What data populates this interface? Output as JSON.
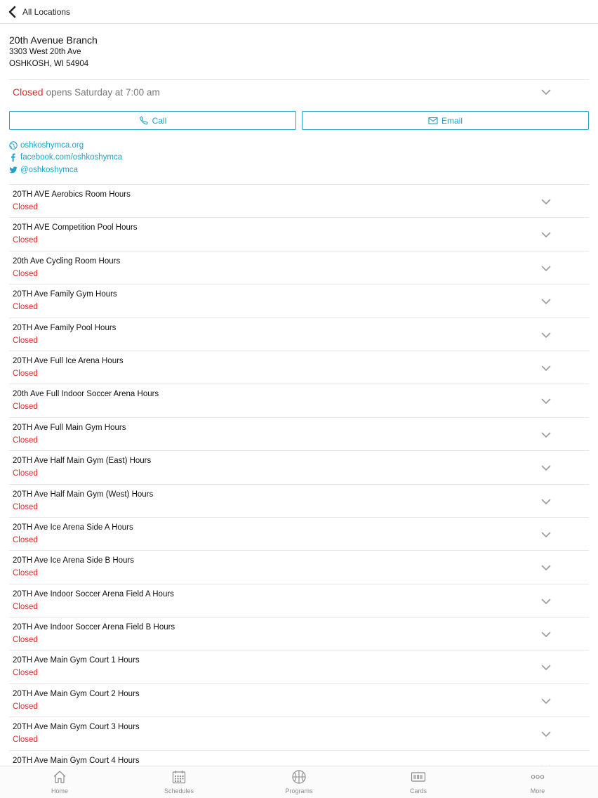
{
  "header": {
    "back_label": "All Locations"
  },
  "location": {
    "name": "20th Avenue Branch",
    "address_line1": "3303 West 20th Ave",
    "address_line2": "OSHKOSH, WI 54904"
  },
  "status": {
    "state": "Closed",
    "detail": "opens Saturday at 7:00 am"
  },
  "actions": {
    "call_label": "Call",
    "email_label": "Email"
  },
  "links": {
    "website": "oshkoshymca.org",
    "facebook": "facebook.com/oshkoshymca",
    "twitter": "@oshkoshymca"
  },
  "facilities": [
    {
      "title": "20TH AVE Aerobics Room Hours",
      "status": "Closed"
    },
    {
      "title": "20TH AVE Competition Pool Hours",
      "status": "Closed"
    },
    {
      "title": "20th Ave Cycling Room Hours",
      "status": "Closed"
    },
    {
      "title": "20TH Ave Family Gym Hours",
      "status": "Closed"
    },
    {
      "title": "20TH Ave Family Pool Hours",
      "status": "Closed"
    },
    {
      "title": "20TH Ave Full Ice Arena Hours",
      "status": "Closed"
    },
    {
      "title": "20th Ave Full Indoor Soccer Arena Hours",
      "status": "Closed"
    },
    {
      "title": "20TH Ave Full Main Gym Hours",
      "status": "Closed"
    },
    {
      "title": "20TH Ave Half Main Gym (East) Hours",
      "status": "Closed"
    },
    {
      "title": "20TH Ave Half Main Gym (West) Hours",
      "status": "Closed"
    },
    {
      "title": "20TH Ave Ice Arena Side A Hours",
      "status": "Closed"
    },
    {
      "title": "20TH Ave Ice Arena Side B Hours",
      "status": "Closed"
    },
    {
      "title": "20TH Ave Indoor Soccer Arena Field A Hours",
      "status": "Closed"
    },
    {
      "title": "20TH Ave Indoor Soccer Arena Field B Hours",
      "status": "Closed"
    },
    {
      "title": "20TH Ave Main Gym Court 1 Hours",
      "status": "Closed"
    },
    {
      "title": "20TH Ave Main Gym Court 2 Hours",
      "status": "Closed"
    },
    {
      "title": "20TH Ave Main Gym Court 3 Hours",
      "status": "Closed"
    },
    {
      "title": "20TH Ave Main Gym Court 4 Hours",
      "status": ""
    }
  ],
  "tabbar": [
    {
      "label": "Home",
      "icon": "home-icon"
    },
    {
      "label": "Schedules",
      "icon": "calendar-icon"
    },
    {
      "label": "Programs",
      "icon": "basketball-icon"
    },
    {
      "label": "Cards",
      "icon": "barcode-card-icon"
    },
    {
      "label": "More",
      "icon": "more-dots-icon"
    }
  ],
  "colors": {
    "accent": "#1fa1c8",
    "closed": "#e02b2b",
    "divider": "#e6e6e6"
  }
}
